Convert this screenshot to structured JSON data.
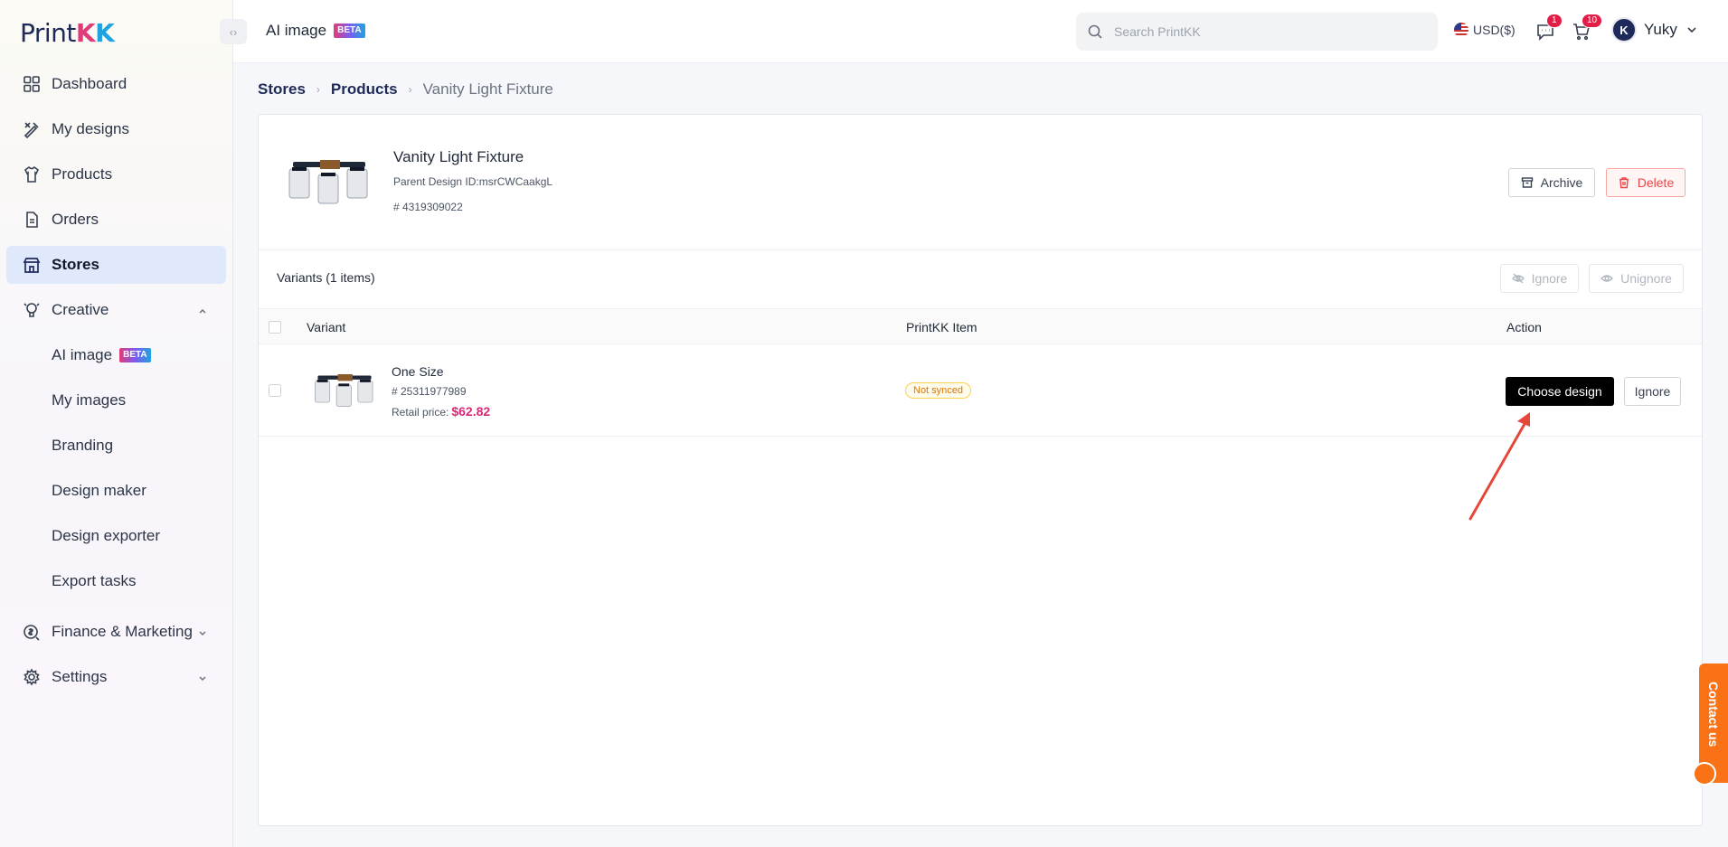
{
  "sidebar": {
    "logo": {
      "part1": "Print",
      "part2": "K",
      "part3": "K"
    },
    "items": [
      {
        "label": "Dashboard",
        "icon": "dashboard-icon"
      },
      {
        "label": "My designs",
        "icon": "design-icon"
      },
      {
        "label": "Products",
        "icon": "tshirt-icon"
      },
      {
        "label": "Orders",
        "icon": "document-icon"
      },
      {
        "label": "Stores",
        "icon": "store-icon",
        "active": true
      },
      {
        "label": "Creative",
        "icon": "creative-icon",
        "expanded": true
      }
    ],
    "creative_sub": [
      {
        "label": "AI image",
        "badge": "BETA"
      },
      {
        "label": "My images"
      },
      {
        "label": "Branding"
      },
      {
        "label": "Design maker"
      },
      {
        "label": "Design exporter"
      },
      {
        "label": "Export tasks"
      }
    ],
    "bottom_items": [
      {
        "label": "Finance & Marketing",
        "icon": "finance-icon"
      },
      {
        "label": "Settings",
        "icon": "gear-icon"
      }
    ]
  },
  "header": {
    "title": "AI image",
    "title_badge": "BETA",
    "search_placeholder": "Search PrintKK",
    "currency": "USD($)",
    "messages_count": "1",
    "cart_count": "10",
    "user_initial": "K",
    "user_name": "Yuky"
  },
  "breadcrumb": {
    "items": [
      "Stores",
      "Products"
    ],
    "current": "Vanity Light Fixture"
  },
  "product": {
    "title": "Vanity Light Fixture",
    "parent_design": "Parent Design ID:msrCWCaakgL",
    "id": "# 4319309022",
    "archive_label": "Archive",
    "delete_label": "Delete"
  },
  "variants": {
    "title": "Variants (1 items)",
    "ignore_label": "Ignore",
    "unignore_label": "Unignore",
    "columns": [
      "Variant",
      "PrintKK Item",
      "Action"
    ],
    "rows": [
      {
        "name": "One Size",
        "id": "# 25311977989",
        "price_label": "Retail price:",
        "price": "$62.82",
        "status": "Not synced",
        "choose_label": "Choose design",
        "ignore_label": "Ignore"
      }
    ]
  },
  "contact": {
    "label": "Contact us"
  },
  "colors": {
    "accent": "#000000",
    "price": "#db2777",
    "active_nav": "#dfe9fb",
    "contact": "#f97316"
  }
}
